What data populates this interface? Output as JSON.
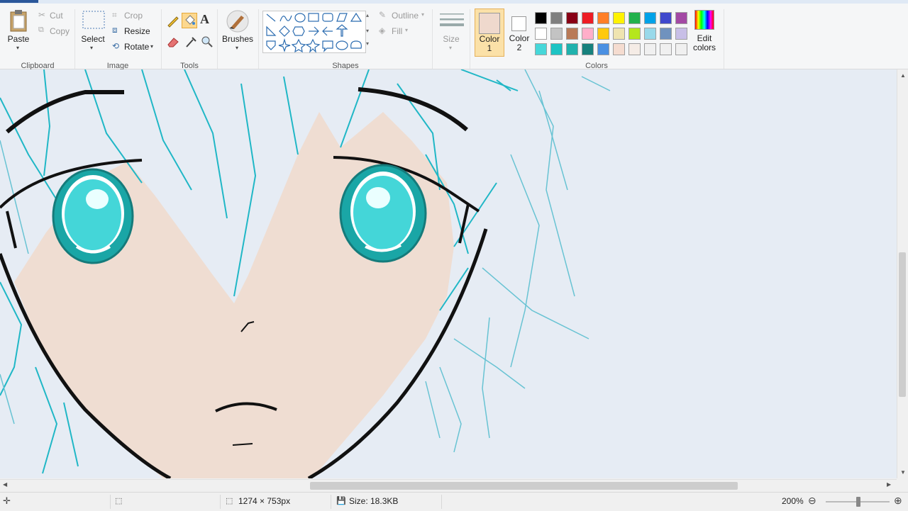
{
  "ribbon": {
    "clipboard": {
      "paste": "Paste",
      "cut": "Cut",
      "copy": "Copy",
      "group": "Clipboard"
    },
    "image": {
      "select": "Select",
      "crop": "Crop",
      "resize": "Resize",
      "rotate": "Rotate",
      "group": "Image"
    },
    "tools": {
      "group": "Tools"
    },
    "brushes": {
      "label": "Brushes"
    },
    "shapes": {
      "outline": "Outline",
      "fill": "Fill",
      "group": "Shapes"
    },
    "size": {
      "label": "Size"
    },
    "colors": {
      "color1_label": "Color\n1",
      "color1_l1": "Color",
      "color1_l2": "1",
      "color2_l1": "Color",
      "color2_l2": "2",
      "edit_l1": "Edit",
      "edit_l2": "colors",
      "group": "Colors",
      "color1": "#efd9cd",
      "color2": "#ffffff",
      "palette_row1": [
        "#000000",
        "#7f7f7f",
        "#880015",
        "#ed1c24",
        "#ff7f27",
        "#fff200",
        "#22b14c",
        "#00a2e8",
        "#3f48cc",
        "#a349a4"
      ],
      "palette_row2": [
        "#ffffff",
        "#c3c3c3",
        "#b97a57",
        "#ffaec9",
        "#ffc90e",
        "#efe4b0",
        "#b5e61d",
        "#99d9ea",
        "#7092be",
        "#c8bfe7"
      ],
      "palette_row3": [
        "#46d7d9",
        "#1ec4c4",
        "#21b2ad",
        "#17817d",
        "#4a90e2",
        "#f5dcd0",
        "#f5ece6",
        "#f0f0f0",
        "#f0f0f0",
        "#f0f0f0"
      ]
    }
  },
  "status": {
    "dimensions": "1274 × 753px",
    "size": "Size: 18.3KB",
    "zoom": "200%"
  }
}
